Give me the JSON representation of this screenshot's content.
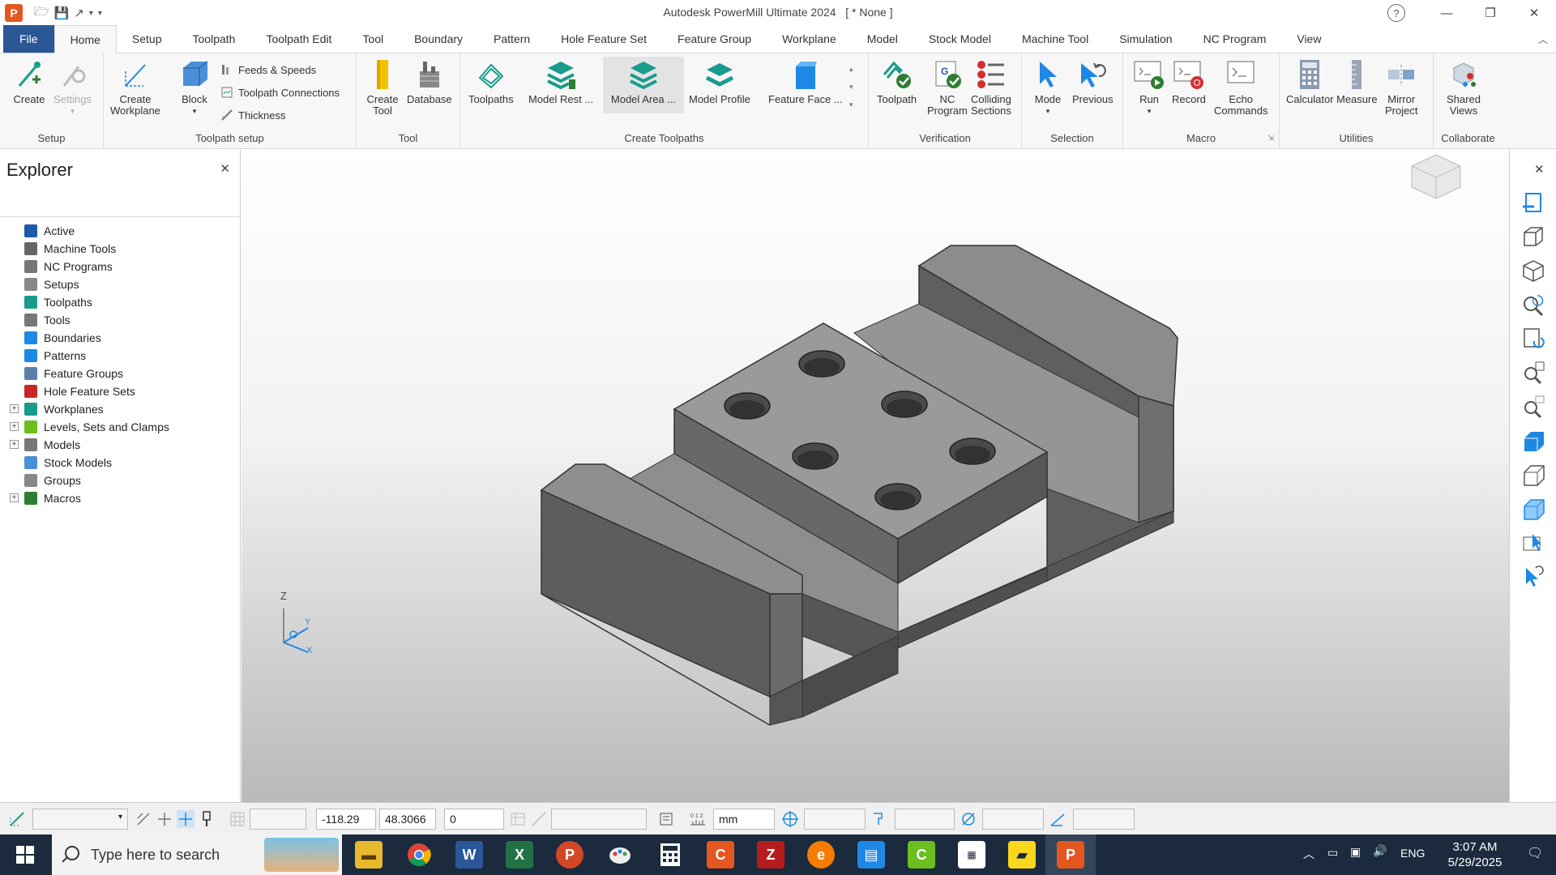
{
  "title": {
    "app_name": "Autodesk PowerMill Ultimate 2024",
    "document": "[ * None ]"
  },
  "tabs": [
    "File",
    "Home",
    "Setup",
    "Toolpath",
    "Toolpath Edit",
    "Tool",
    "Boundary",
    "Pattern",
    "Hole Feature Set",
    "Feature Group",
    "Workplane",
    "Model",
    "Stock Model",
    "Machine Tool",
    "Simulation",
    "NC Program",
    "View"
  ],
  "active_tab": "Home",
  "ribbon": {
    "setup": {
      "label": "Setup",
      "create": "Create",
      "settings": "Settings"
    },
    "toolpath_setup": {
      "label": "Toolpath setup",
      "create_workplane_1": "Create",
      "create_workplane_2": "Workplane",
      "block": "Block",
      "feeds_speeds": "Feeds & Speeds",
      "toolpath_connections": "Toolpath Connections",
      "thickness": "Thickness"
    },
    "tool": {
      "label": "Tool",
      "create_tool_1": "Create",
      "create_tool_2": "Tool",
      "database": "Database"
    },
    "create_toolpaths": {
      "label": "Create Toolpaths",
      "toolpaths": "Toolpaths",
      "model_rest": "Model Rest ...",
      "model_area": "Model Area ...",
      "model_profile": "Model Profile",
      "feature_face": "Feature Face ..."
    },
    "verification": {
      "label": "Verification",
      "toolpath": "Toolpath",
      "nc_program_1": "NC",
      "nc_program_2": "Program",
      "colliding_1": "Colliding",
      "colliding_2": "Sections"
    },
    "selection": {
      "label": "Selection",
      "mode": "Mode",
      "previous": "Previous"
    },
    "macro": {
      "label": "Macro",
      "run": "Run",
      "record": "Record",
      "echo_1": "Echo",
      "echo_2": "Commands"
    },
    "utilities": {
      "label": "Utilities",
      "calculator": "Calculator",
      "measure": "Measure",
      "mirror_1": "Mirror",
      "mirror_2": "Project"
    },
    "collaborate": {
      "label": "Collaborate",
      "shared_1": "Shared",
      "shared_2": "Views"
    }
  },
  "explorer": {
    "title": "Explorer",
    "items": [
      {
        "label": "Active",
        "expandable": false
      },
      {
        "label": "Machine Tools",
        "expandable": false
      },
      {
        "label": "NC Programs",
        "expandable": false
      },
      {
        "label": "Setups",
        "expandable": false
      },
      {
        "label": "Toolpaths",
        "expandable": false
      },
      {
        "label": "Tools",
        "expandable": false
      },
      {
        "label": "Boundaries",
        "expandable": false
      },
      {
        "label": "Patterns",
        "expandable": false
      },
      {
        "label": "Feature Groups",
        "expandable": false
      },
      {
        "label": "Hole Feature Sets",
        "expandable": false
      },
      {
        "label": "Workplanes",
        "expandable": true
      },
      {
        "label": "Levels, Sets and Clamps",
        "expandable": true
      },
      {
        "label": "Models",
        "expandable": true
      },
      {
        "label": "Stock Models",
        "expandable": false
      },
      {
        "label": "Groups",
        "expandable": false
      },
      {
        "label": "Macros",
        "expandable": true
      }
    ]
  },
  "viewport": {
    "axis_z": "Z",
    "axis_y": "Y",
    "axis_x": "X"
  },
  "status": {
    "x_coord": "-118.29",
    "y_coord": "48.3066",
    "z_coord": "0",
    "units": "mm"
  },
  "taskbar": {
    "search_placeholder": "Type here to search",
    "language": "ENG",
    "time": "3:07 AM",
    "date": "5/29/2025"
  },
  "colors": {
    "file_tab": "#2b5797",
    "taskbar": "#1b2a3d",
    "accent_teal": "#1a9c8c",
    "accent_blue": "#1e88e5"
  }
}
